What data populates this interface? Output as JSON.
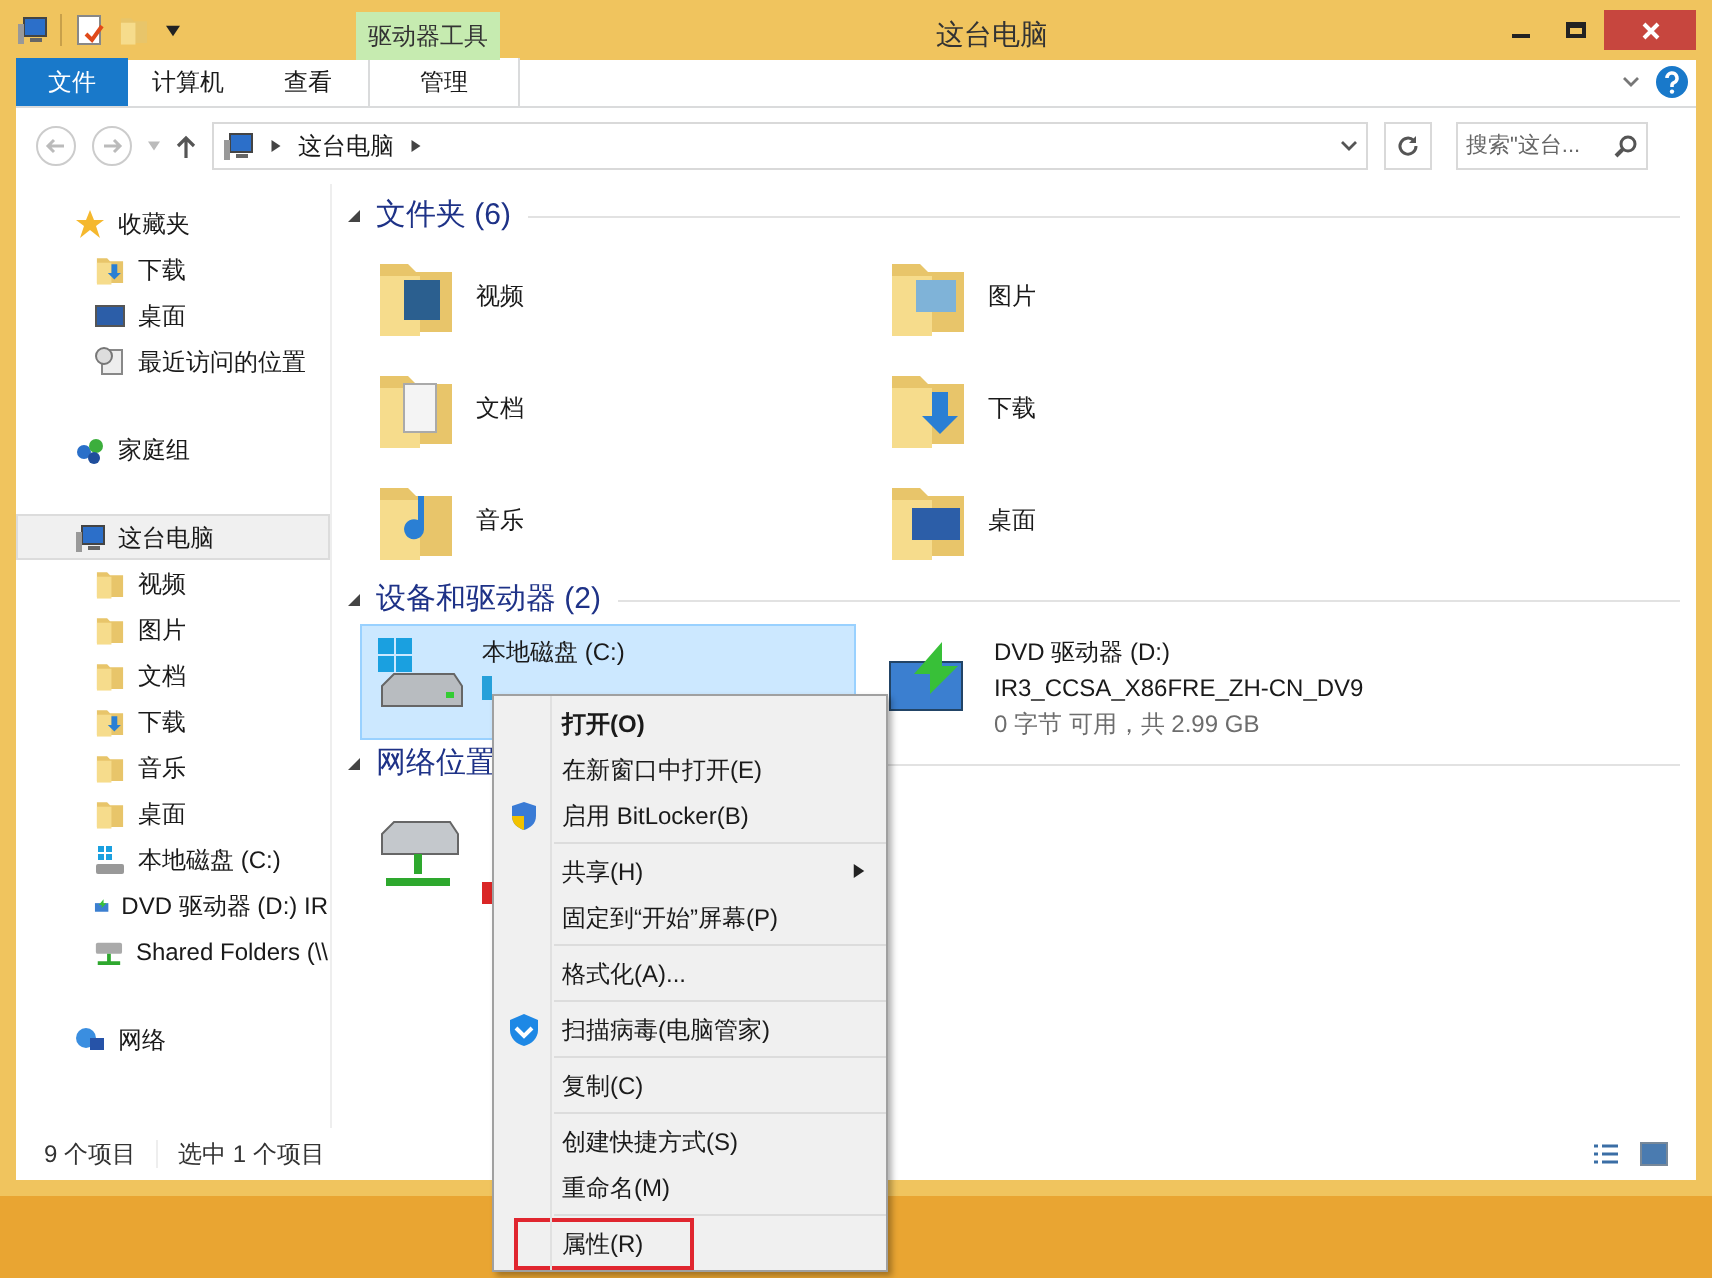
{
  "window": {
    "title": "这台电脑"
  },
  "quick_access": {
    "tool_tab": "驱动器工具"
  },
  "ribbon_tabs": [
    {
      "label": "文件",
      "kind": "file",
      "selected": false
    },
    {
      "label": "计算机",
      "kind": "tab",
      "selected": false
    },
    {
      "label": "查看",
      "kind": "tab",
      "selected": false
    },
    {
      "label": "管理",
      "kind": "tool",
      "selected": false
    }
  ],
  "address_bar": {
    "path": "这台电脑"
  },
  "search": {
    "placeholder": "搜索\"这台..."
  },
  "sidebar": {
    "items": [
      {
        "label": "收藏夹",
        "kind": "star",
        "selected": false,
        "children": [
          {
            "label": "下载",
            "kind": "download-folder",
            "selected": false
          },
          {
            "label": "桌面",
            "kind": "desktop",
            "selected": false
          },
          {
            "label": "最近访问的位置",
            "kind": "recent",
            "selected": false
          }
        ]
      },
      {
        "label": "家庭组",
        "kind": "homegroup",
        "selected": false
      },
      {
        "label": "这台电脑",
        "kind": "pc",
        "selected": true,
        "children": [
          {
            "label": "视频",
            "kind": "folder",
            "selected": false
          },
          {
            "label": "图片",
            "kind": "folder",
            "selected": false
          },
          {
            "label": "文档",
            "kind": "folder",
            "selected": false
          },
          {
            "label": "下载",
            "kind": "download-folder",
            "selected": false
          },
          {
            "label": "音乐",
            "kind": "folder",
            "selected": false
          },
          {
            "label": "桌面",
            "kind": "folder",
            "selected": false
          },
          {
            "label": "本地磁盘 (C:)",
            "kind": "drive",
            "selected": false
          },
          {
            "label": "DVD 驱动器 (D:) IR",
            "kind": "dvd",
            "selected": false
          },
          {
            "label": "Shared Folders (\\\\",
            "kind": "network-drive",
            "selected": false
          }
        ]
      },
      {
        "label": "网络",
        "kind": "network",
        "selected": false
      }
    ]
  },
  "folders_section": {
    "title": "文件夹 (6)",
    "items": [
      {
        "label": "视频",
        "kind": "video"
      },
      {
        "label": "图片",
        "kind": "picture"
      },
      {
        "label": "文档",
        "kind": "document"
      },
      {
        "label": "下载",
        "kind": "download"
      },
      {
        "label": "音乐",
        "kind": "music"
      },
      {
        "label": "桌面",
        "kind": "desktop"
      }
    ]
  },
  "devices_section": {
    "title": "设备和驱动器 (2)",
    "items": [
      {
        "name": "本地磁盘 (C:)",
        "kind": "disk",
        "selected": true,
        "color": "#26a0da"
      },
      {
        "name": "DVD 驱动器 (D:)",
        "line_2": "IR3_CCSA_X86FRE_ZH-CN_DV9",
        "line_3": "0 字节 可用，共 2.99 GB",
        "kind": "dvd",
        "selected": false
      }
    ]
  },
  "network_section": {
    "title": "网络位置",
    "items": [
      {
        "kind": "network-drive",
        "selected": false,
        "color": "#da2626"
      }
    ]
  },
  "status_bar": {
    "count": "9 个项目",
    "selection": "选中 1 个项目"
  },
  "context_menu": {
    "groups": [
      [
        {
          "label": "打开(O)",
          "bold": true,
          "kind": "plain",
          "submenu": false,
          "highlighted": false
        },
        {
          "label": "在新窗口中打开(E)",
          "bold": false,
          "kind": "plain",
          "submenu": false,
          "highlighted": false
        },
        {
          "label": "启用 BitLocker(B)",
          "bold": false,
          "kind": "shield",
          "submenu": false,
          "highlighted": false
        }
      ],
      [
        {
          "label": "共享(H)",
          "bold": false,
          "kind": "plain",
          "submenu": true,
          "highlighted": false
        },
        {
          "label": "固定到“开始”屏幕(P)",
          "bold": false,
          "kind": "plain",
          "submenu": false,
          "highlighted": false
        }
      ],
      [
        {
          "label": "格式化(A)...",
          "bold": false,
          "kind": "plain",
          "submenu": false,
          "highlighted": false
        }
      ],
      [
        {
          "label": "扫描病毒(电脑管家)",
          "bold": false,
          "kind": "guard",
          "submenu": false,
          "highlighted": false
        }
      ],
      [
        {
          "label": "复制(C)",
          "bold": false,
          "kind": "plain",
          "submenu": false,
          "highlighted": false
        }
      ],
      [
        {
          "label": "创建快捷方式(S)",
          "bold": false,
          "kind": "plain",
          "submenu": false,
          "highlighted": false
        },
        {
          "label": "重命名(M)",
          "bold": false,
          "kind": "plain",
          "submenu": false,
          "highlighted": false
        }
      ],
      [
        {
          "label": "属性(R)",
          "bold": false,
          "kind": "plain",
          "submenu": false,
          "highlighted": true
        }
      ]
    ]
  }
}
